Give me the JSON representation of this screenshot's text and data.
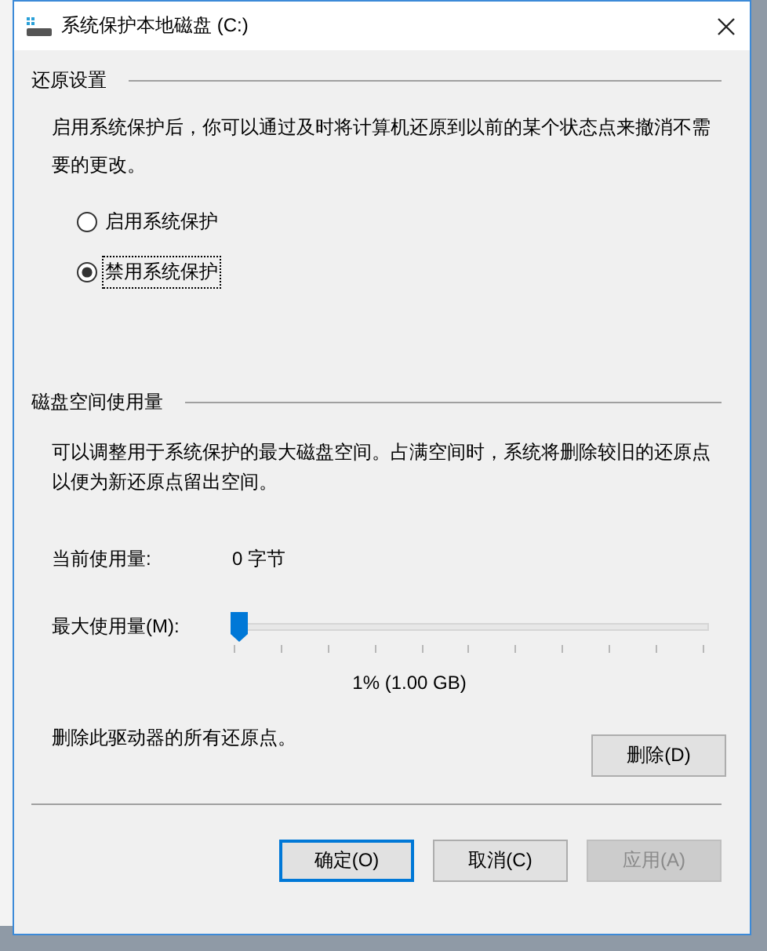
{
  "window": {
    "title": "系统保护本地磁盘 (C:)"
  },
  "restore_settings": {
    "heading": "还原设置",
    "description": "启用系统保护后，你可以通过及时将计算机还原到以前的某个状态点来撤消不需要的更改。",
    "options": [
      {
        "label": "启用系统保护",
        "selected": false,
        "focused": false
      },
      {
        "label": "禁用系统保护",
        "selected": true,
        "focused": true
      }
    ]
  },
  "disk_space": {
    "heading": "磁盘空间使用量",
    "description": "可以调整用于系统保护的最大磁盘空间。占满空间时，系统将删除较旧的还原点以便为新还原点留出空间。",
    "current_usage_label": "当前使用量:",
    "current_usage_value": "0 字节",
    "max_usage_label": "最大使用量(M):",
    "slider": {
      "level": 0.01
    },
    "max_usage_reading": "1% (1.00 GB)",
    "delete_text": "删除此驱动器的所有还原点。",
    "delete_button": "删除(D)"
  },
  "buttons": [
    {
      "label": "确定(O)",
      "default": true,
      "disabled": false
    },
    {
      "label": "取消(C)",
      "default": false,
      "disabled": false
    },
    {
      "label": "应用(A)",
      "default": false,
      "disabled": true
    }
  ]
}
